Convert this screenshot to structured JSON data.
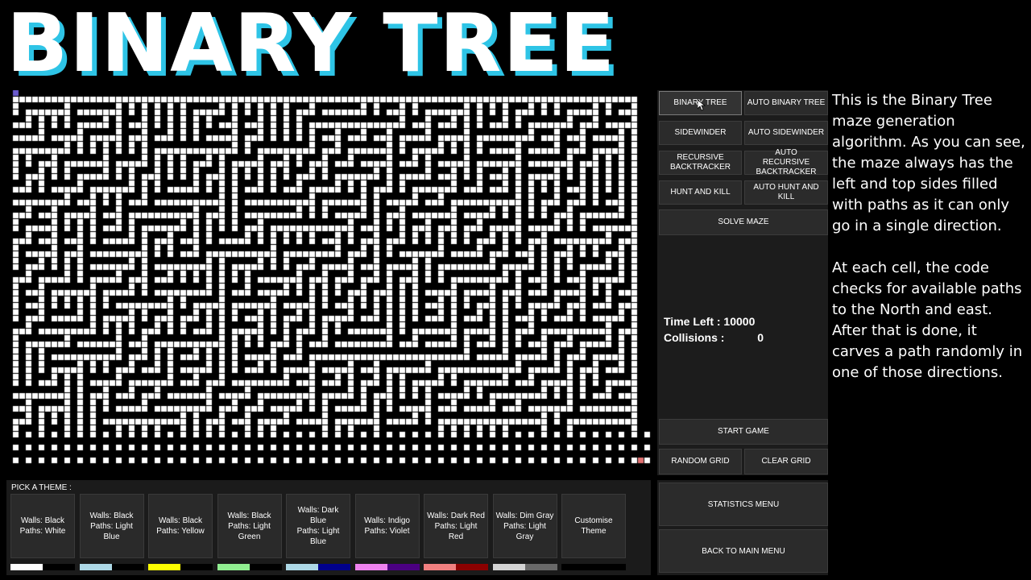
{
  "title": "BINARY TREE",
  "colors": {
    "title_shadow": "#2ec4e6",
    "start_cell": "#6a5acd",
    "end_cell": "#e07070",
    "path": "#ffffff",
    "wall": "#000000"
  },
  "buttons": {
    "binary_tree": "BINARY TREE",
    "auto_binary_tree": "AUTO BINARY TREE",
    "sidewinder": "SIDEWINDER",
    "auto_sidewinder": "AUTO SIDEWINDER",
    "recursive_backtracker": "RECURSIVE BACKTRACKER",
    "auto_recursive_backtracker": "AUTO RECURSIVE BACKTRACKER",
    "hunt_and_kill": "HUNT AND KILL",
    "auto_hunt_and_kill": "AUTO HUNT AND KILL",
    "solve_maze": "SOLVE MAZE",
    "start_game": "START GAME",
    "random_grid": "RANDOM GRID",
    "clear_grid": "CLEAR GRID",
    "statistics_menu": "STATISTICS MENU",
    "back_to_main_menu": "BACK TO MAIN MENU"
  },
  "stats": {
    "time_left_label": "Time Left :",
    "time_left_value": "10000",
    "collisions_label": "Collisions :",
    "collisions_value": "0"
  },
  "theme": {
    "label": "PICK A THEME :",
    "cards": [
      {
        "line1": "Walls: Black",
        "line2": "Paths: White",
        "colors": [
          "#ffffff",
          "#000000"
        ]
      },
      {
        "line1": "Walls: Black",
        "line2": "Paths: Light Blue",
        "colors": [
          "#add8e6",
          "#000000"
        ]
      },
      {
        "line1": "Walls: Black",
        "line2": "Paths: Yellow",
        "colors": [
          "#ffff00",
          "#000000"
        ]
      },
      {
        "line1": "Walls: Black",
        "line2": "Paths: Light Green",
        "colors": [
          "#90ee90",
          "#000000"
        ]
      },
      {
        "line1": "Walls: Dark Blue",
        "line2": "Paths: Light Blue",
        "colors": [
          "#add8e6",
          "#00008b"
        ]
      },
      {
        "line1": "Walls: Indigo",
        "line2": "Paths: Violet",
        "colors": [
          "#ee82ee",
          "#4b0082"
        ]
      },
      {
        "line1": "Walls: Dark Red",
        "line2": "Paths: Light Red",
        "colors": [
          "#f08080",
          "#8b0000"
        ]
      },
      {
        "line1": "Walls: Dim Gray",
        "line2": "Paths: Light Gray",
        "colors": [
          "#d3d3d3",
          "#696969"
        ]
      },
      {
        "line1": "Customise",
        "line2": "Theme",
        "colors": [
          "#000000",
          "#000000"
        ]
      }
    ]
  },
  "description": {
    "para1": "This is the Binary Tree maze generation algorithm. As you can see, the maze always has the left and top sides filled with paths as it can only go in a single direction.",
    "para2": "At each cell, the code checks for available paths to the North and east. After that is done, it carves a path randomly in one of those directions."
  }
}
